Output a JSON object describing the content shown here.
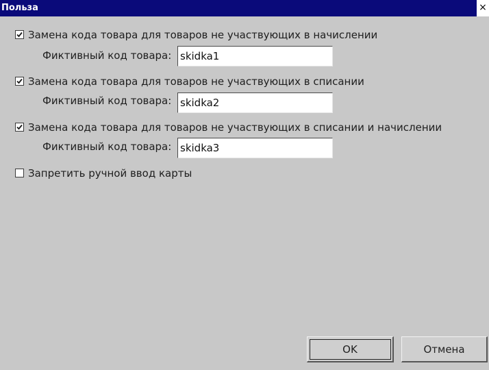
{
  "window": {
    "title": "Польза",
    "close_glyph": "×"
  },
  "options": [
    {
      "label": "Замена кода товара для товаров не участвующих в начислении",
      "checked": true,
      "field_label": "Фиктивный код товара:",
      "field_value": "skidka1"
    },
    {
      "label": "Замена кода товара для товаров не участвующих в списании",
      "checked": true,
      "field_label": "Фиктивный код товара:",
      "field_value": "skidka2"
    },
    {
      "label": "Замена кода товара для товаров не участвующих в списании и начислении",
      "checked": true,
      "field_label": "Фиктивный код товара:",
      "field_value": "skidka3"
    }
  ],
  "manual_card": {
    "label": "Запретить ручной ввод карты",
    "checked": false
  },
  "buttons": {
    "ok": "OK",
    "cancel": "Отмена"
  },
  "colors": {
    "titlebar": "#0a0a7a",
    "background": "#c8c8c8"
  },
  "icons": {
    "checkbox_mark": "check-icon"
  }
}
